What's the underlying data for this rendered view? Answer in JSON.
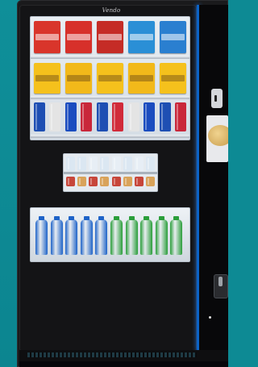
{
  "machine": {
    "brand": "Vendo",
    "colors": {
      "background": "#0d8a94",
      "cabinet": "#1a1a1c",
      "accent_light": "#0b63c7"
    }
  },
  "shelves": {
    "top_row": {
      "colors": [
        "#d9352b",
        "#d7302a",
        "#c52c26",
        "#2a8fd6",
        "#2a7fd0"
      ]
    },
    "second_row": {
      "colors": [
        "#f5c11c",
        "#f2b91a",
        "#f5c11c",
        "#f2b91a",
        "#f5c11c"
      ]
    },
    "cans_row": {
      "colors": [
        "#1e4fb3",
        "#e4e4e4",
        "#1a4cbf",
        "#c9273a",
        "#1e4fb3",
        "#d12b3a",
        "#e4e4e4",
        "#1a4cbf",
        "#1e4fb3",
        "#c9273a"
      ]
    },
    "middle_drinks": {
      "colors": [
        "#dbe7f2",
        "#dbe7f2",
        "#e7eef5",
        "#dbe7f2",
        "#e7eef5",
        "#dbe7f2",
        "#e7eef5",
        "#dbe7f2"
      ]
    },
    "bottles": {
      "colors": [
        "#1e63c8",
        "#1e63c8",
        "#1e63c8",
        "#1e63c8",
        "#1e63c8",
        "#2a9e3a",
        "#2a9e3a",
        "#2a9e3a",
        "#2a9e3a",
        "#2a9e3a"
      ]
    }
  },
  "controls": {
    "coin_slot": "coin-slot-icon",
    "screen": "food-ad-screen",
    "pickup": "pickup-door-icon"
  }
}
